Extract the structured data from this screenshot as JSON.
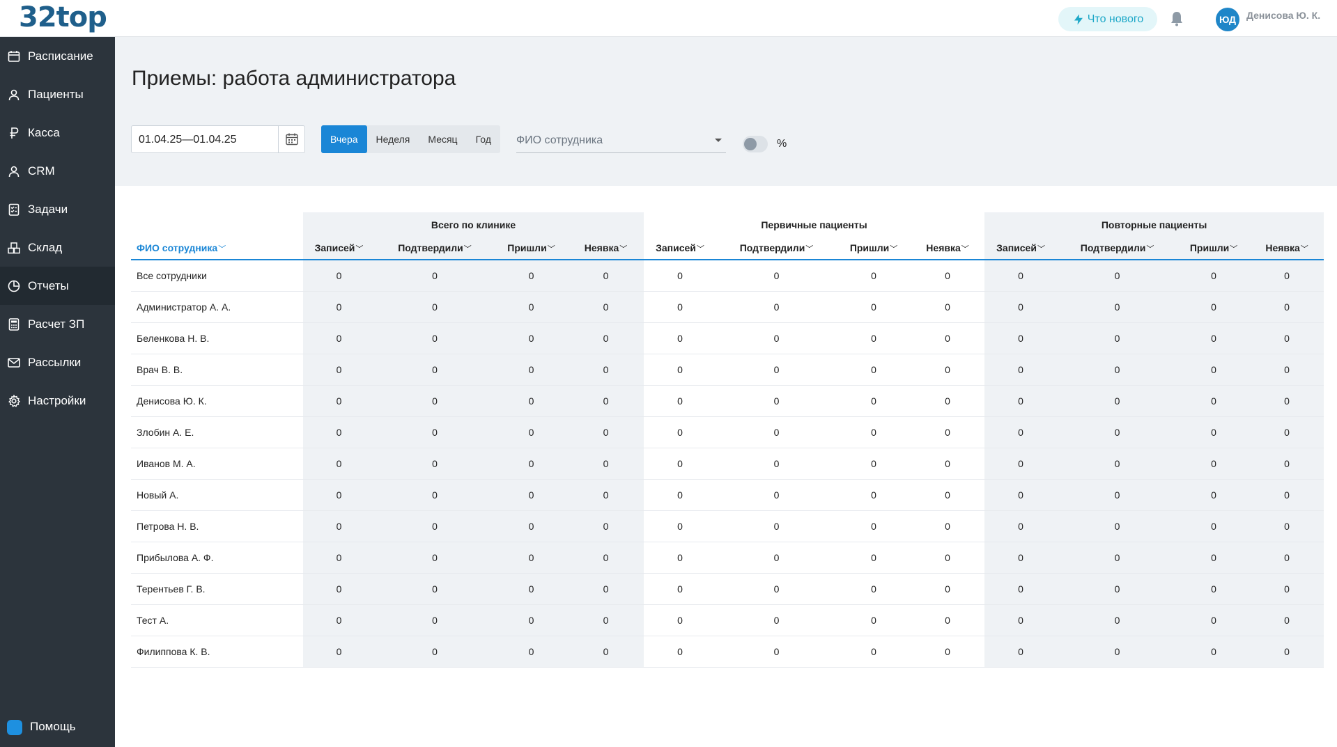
{
  "app": {
    "logo": "32top"
  },
  "header": {
    "whats_new": "Что нового",
    "user_initials": "ЮД",
    "user_name": "Денисова Ю. К."
  },
  "sidebar": {
    "items": [
      {
        "label": "Расписание",
        "icon": "calendar-icon"
      },
      {
        "label": "Пациенты",
        "icon": "person-icon"
      },
      {
        "label": "Касса",
        "icon": "ruble-icon"
      },
      {
        "label": "CRM",
        "icon": "person-icon"
      },
      {
        "label": "Задачи",
        "icon": "checklist-icon"
      },
      {
        "label": "Склад",
        "icon": "boxes-icon"
      },
      {
        "label": "Отчеты",
        "icon": "pie-chart-icon"
      },
      {
        "label": "Расчет ЗП",
        "icon": "calculator-icon"
      },
      {
        "label": "Рассылки",
        "icon": "mail-icon"
      },
      {
        "label": "Настройки",
        "icon": "gear-icon"
      }
    ],
    "active": "Отчеты",
    "help": "Помощь"
  },
  "page": {
    "title": "Приемы: работа администратора"
  },
  "filters": {
    "date_range": "01.04.25—01.04.25",
    "periods": [
      "Вчера",
      "Неделя",
      "Месяц",
      "Год"
    ],
    "active_period": "Вчера",
    "employee_placeholder": "ФИО сотрудника",
    "percent_label": "%",
    "percent_toggle_on": false
  },
  "table": {
    "groups": [
      "Всего по клинике",
      "Первичные пациенты",
      "Повторные пациенты"
    ],
    "name_header": "ФИО сотрудника",
    "columns": [
      "Записей",
      "Подтвердили",
      "Пришли",
      "Неявка"
    ],
    "rows": [
      {
        "name": "Все сотрудники",
        "values": [
          0,
          0,
          0,
          0,
          0,
          0,
          0,
          0,
          0,
          0,
          0,
          0
        ]
      },
      {
        "name": "Администратор А. А.",
        "values": [
          0,
          0,
          0,
          0,
          0,
          0,
          0,
          0,
          0,
          0,
          0,
          0
        ]
      },
      {
        "name": "Беленкова Н. В.",
        "values": [
          0,
          0,
          0,
          0,
          0,
          0,
          0,
          0,
          0,
          0,
          0,
          0
        ]
      },
      {
        "name": "Врач В. В.",
        "values": [
          0,
          0,
          0,
          0,
          0,
          0,
          0,
          0,
          0,
          0,
          0,
          0
        ]
      },
      {
        "name": "Денисова Ю. К.",
        "values": [
          0,
          0,
          0,
          0,
          0,
          0,
          0,
          0,
          0,
          0,
          0,
          0
        ]
      },
      {
        "name": "Злобин А. Е.",
        "values": [
          0,
          0,
          0,
          0,
          0,
          0,
          0,
          0,
          0,
          0,
          0,
          0
        ]
      },
      {
        "name": "Иванов М. А.",
        "values": [
          0,
          0,
          0,
          0,
          0,
          0,
          0,
          0,
          0,
          0,
          0,
          0
        ]
      },
      {
        "name": "Новый А.",
        "values": [
          0,
          0,
          0,
          0,
          0,
          0,
          0,
          0,
          0,
          0,
          0,
          0
        ]
      },
      {
        "name": "Петрова Н. В.",
        "values": [
          0,
          0,
          0,
          0,
          0,
          0,
          0,
          0,
          0,
          0,
          0,
          0
        ]
      },
      {
        "name": "Прибылова А. Ф.",
        "values": [
          0,
          0,
          0,
          0,
          0,
          0,
          0,
          0,
          0,
          0,
          0,
          0
        ]
      },
      {
        "name": "Терентьев Г. В.",
        "values": [
          0,
          0,
          0,
          0,
          0,
          0,
          0,
          0,
          0,
          0,
          0,
          0
        ]
      },
      {
        "name": "Тест А.",
        "values": [
          0,
          0,
          0,
          0,
          0,
          0,
          0,
          0,
          0,
          0,
          0,
          0
        ]
      },
      {
        "name": "Филиппова К. В.",
        "values": [
          0,
          0,
          0,
          0,
          0,
          0,
          0,
          0,
          0,
          0,
          0,
          0
        ]
      }
    ]
  },
  "colors": {
    "accent": "#1a86d6",
    "sidebar": "#2c343c",
    "logo": "#1f5f8b",
    "panel": "#eff2f5"
  }
}
